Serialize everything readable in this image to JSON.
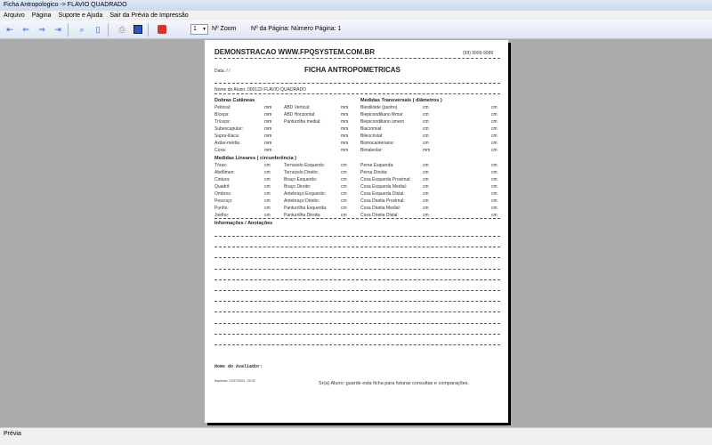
{
  "window": {
    "title": "Ficha Antropologico -> FLAVIO QUADRADO"
  },
  "menu": [
    "Arquivo",
    "Página",
    "Suporte e Ajuda",
    "Sair da Prévia de Impressão"
  ],
  "toolbar": {
    "icons": [
      "first-page-icon",
      "prev-page-icon",
      "next-page-icon",
      "last-page-icon",
      "zoom-icon",
      "two-pages-icon",
      "print-icon",
      "export-icon",
      "close-icon"
    ],
    "zoom_value": "1",
    "zoom_label": "Nº Zoom",
    "page_label": "Nº da Página: Número Página: 1"
  },
  "doc": {
    "company": "DEMONSTRACAO WWW.FPQSYSTEM.COM.BR",
    "phone": "(99) 9999-9999",
    "date": "Data:  /  /",
    "title": "FICHA ANTROPOMETRICAS",
    "student": "Nome do Aluno: 000122-FLAVIO QUADRADO",
    "dobras_title": "Dobras Cutâneas",
    "dobras_a": [
      [
        "Peitoral:",
        "mm"
      ],
      [
        "Bíceps:",
        "mm"
      ],
      [
        "Tríceps:",
        "mm"
      ],
      [
        "Subescapular:",
        "mm"
      ],
      [
        "Supra-ilíaca:",
        "mm"
      ],
      [
        "Axilar-média:",
        "mm"
      ],
      [
        "Coxa:",
        "mm"
      ]
    ],
    "dobras_b": [
      [
        "ABD Vertical:",
        "mm"
      ],
      [
        "ABD Horizontal:",
        "mm"
      ],
      [
        "Panturrilha medial:",
        "mm"
      ],
      [
        "",
        "mm"
      ],
      [
        "",
        "mm"
      ],
      [
        "",
        "mm"
      ],
      [
        "",
        "mm"
      ]
    ],
    "trans_title": "Medidas Transversais ( diâmetros )",
    "trans": [
      [
        "Biestilóide (punho)",
        "cm",
        "cm"
      ],
      [
        "Biepicondiliano fêmur",
        "cm",
        "cm"
      ],
      [
        "Biepicondiliano úmero",
        "cm",
        "cm"
      ],
      [
        "Biacromial:",
        "cm",
        "cm"
      ],
      [
        "Bileocristal:",
        "cm",
        "cm"
      ],
      [
        "Biotrocanteriano:",
        "cm",
        "cm"
      ],
      [
        "Bimaleolar:",
        "mm",
        "cm"
      ]
    ],
    "lin_title": "Medidas Lineares ( circunferência )",
    "lin": [
      [
        "Tórax:",
        "cm",
        "Tornozelo Esquerdo:",
        "cm",
        "Perna Esquerda:",
        "cm",
        "cm"
      ],
      [
        "Abdômen:",
        "cm",
        "Tornozelo Direito:",
        "cm",
        "Perna Direita:",
        "cm",
        "cm"
      ],
      [
        "Cintura:",
        "cm",
        "Braço Esquerdo:",
        "cm",
        "Coxa Esquerda Proximal:",
        "cm",
        "cm"
      ],
      [
        "Quadril:",
        "cm",
        "Braço Direito:",
        "cm",
        "Coxa Esquerda Medial:",
        "cm",
        "cm"
      ],
      [
        "Ombros:",
        "cm",
        "Antebraço Esquerdo:",
        "cm",
        "Coxa Esquerda Distal:",
        "cm",
        "cm"
      ],
      [
        "Pescoço:",
        "cm",
        "Antebraço Direito:",
        "cm",
        "Coxa Direita Proximal:",
        "cm",
        "cm"
      ],
      [
        "Punho:",
        "cm",
        "Panturrilha Esquerda:",
        "cm",
        "Coxa Direita Medial:",
        "cm",
        "cm"
      ],
      [
        "Joelho:",
        "cm",
        "Panturrilha Direita:",
        "cm",
        "Coxa Direita Distal:",
        "cm",
        "cm"
      ]
    ],
    "notes_title": "Informações / Anotações",
    "evaluator": "Nome do Avaliador:",
    "printed": "Impresso: 01/07/2024 - 20:32",
    "footer_msg": "Sr(a) Aluno: guarde esta ficha para futuras consultas e comparações."
  },
  "status": "Prévia"
}
